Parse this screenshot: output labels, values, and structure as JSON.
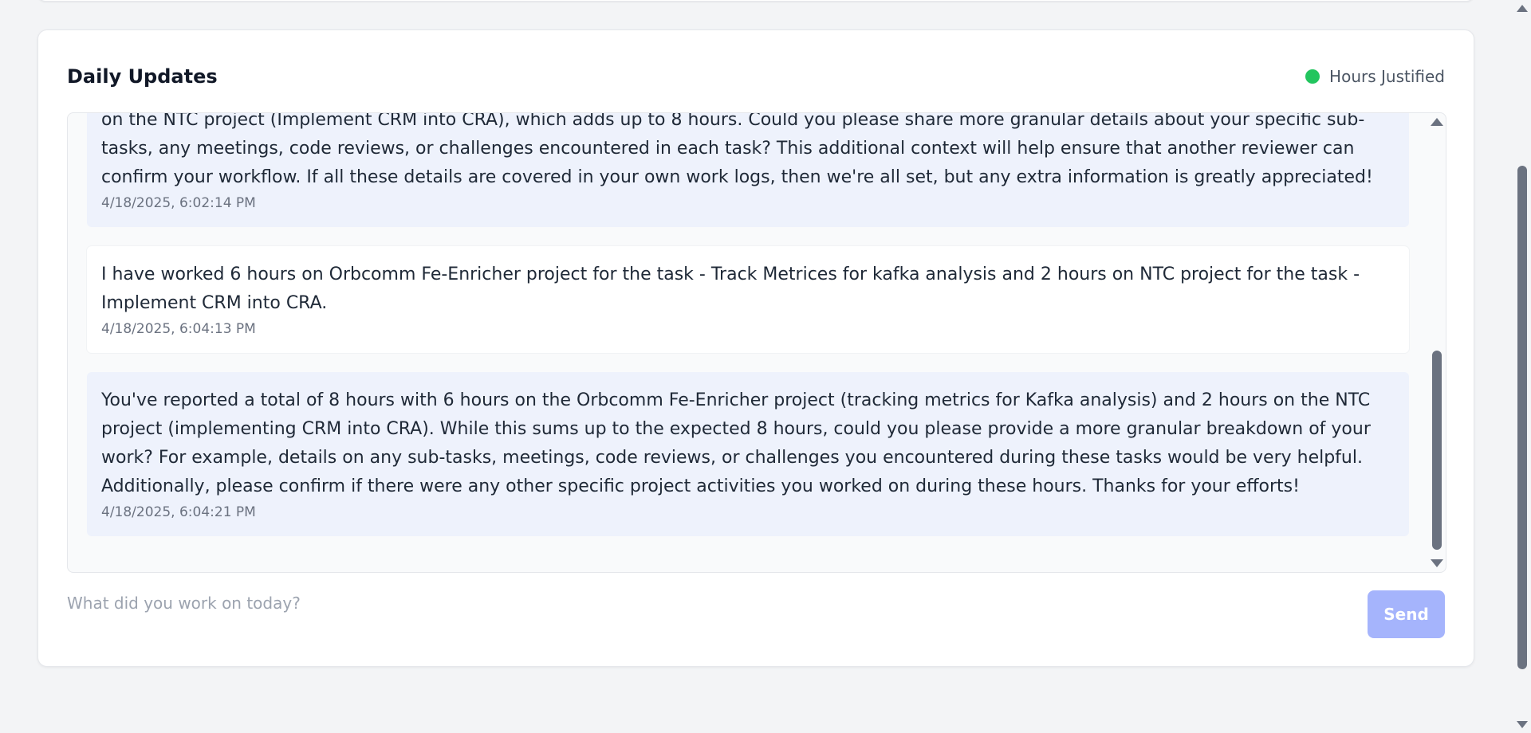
{
  "daily_updates": {
    "title": "Daily Updates",
    "status": {
      "label": "Hours Justified",
      "color": "#22c55e"
    },
    "messages": [
      {
        "role": "assistant",
        "text": "on the NTC project (Implement CRM into CRA), which adds up to 8 hours. Could you please share more granular details about your specific sub-tasks, any meetings, code reviews, or challenges encountered in each task? This additional context will help ensure that another reviewer can confirm your workflow. If all these details are covered in your own work logs, then we're all set, but any extra information is greatly appreciated!",
        "timestamp": "4/18/2025, 6:02:14 PM"
      },
      {
        "role": "user",
        "text": "I have worked 6 hours on Orbcomm Fe-Enricher project for the task - Track Metrices for kafka analysis and 2 hours on NTC project for the task - Implement CRM into CRA.",
        "timestamp": "4/18/2025, 6:04:13 PM"
      },
      {
        "role": "assistant",
        "text": "You've reported a total of 8 hours with 6 hours on the Orbcomm Fe-Enricher project (tracking metrics for Kafka analysis) and 2 hours on the NTC project (implementing CRM into CRA). While this sums up to the expected 8 hours, could you please provide a more granular breakdown of your work? For example, details on any sub-tasks, meetings, code reviews, or challenges you encountered during these tasks would be very helpful. Additionally, please confirm if there were any other specific project activities you worked on during these hours. Thanks for your efforts!",
        "timestamp": "4/18/2025, 6:04:21 PM"
      }
    ],
    "input": {
      "value": "",
      "placeholder": "What did you work on today?"
    },
    "send_label": "Send",
    "accent_color": "#a5b4fc"
  }
}
